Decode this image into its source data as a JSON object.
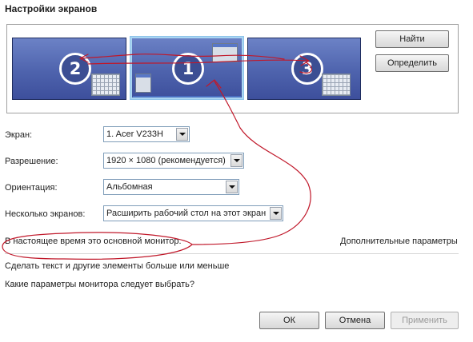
{
  "window": {
    "title": "Настройки экранов"
  },
  "monitors": [
    {
      "number": "2",
      "selected": false
    },
    {
      "number": "1",
      "selected": true
    },
    {
      "number": "3",
      "selected": false
    }
  ],
  "buttons": {
    "find": "Найти",
    "identify": "Определить",
    "ok": "ОК",
    "cancel": "Отмена",
    "apply": "Применить"
  },
  "fields": {
    "screen": {
      "label": "Экран:",
      "value": "1. Acer V233H"
    },
    "resolution": {
      "label": "Разрешение:",
      "value": "1920 × 1080 (рекомендуется)"
    },
    "orientation": {
      "label": "Ориентация:",
      "value": "Альбомная"
    },
    "multiple": {
      "label": "Несколько экранов:",
      "value": "Расширить рабочий стол на этот экран"
    }
  },
  "status": {
    "primary_monitor": "В настоящее время это основной монитор."
  },
  "links": {
    "advanced": "Дополнительные параметры",
    "text_size": "Сделать текст и другие элементы больше или меньше",
    "which_settings": "Какие параметры монитора следует выбрать?"
  },
  "colors": {
    "annotation": "#c0182a",
    "monitor_fill": "#4e63ad",
    "selected_border": "#8ec4ea"
  }
}
